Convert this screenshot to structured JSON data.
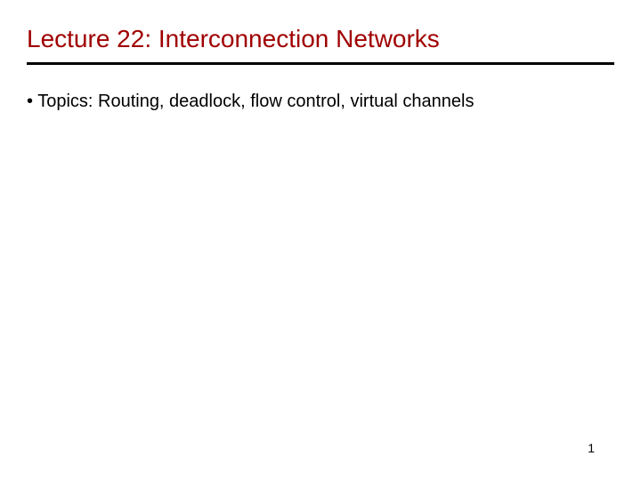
{
  "slide": {
    "title": "Lecture 22: Interconnection Networks",
    "bullet": "• Topics: Routing, deadlock, flow control, virtual channels",
    "page_number": "1"
  },
  "colors": {
    "title_color": "#a00000",
    "text_color": "#000000",
    "divider_color": "#000000"
  }
}
